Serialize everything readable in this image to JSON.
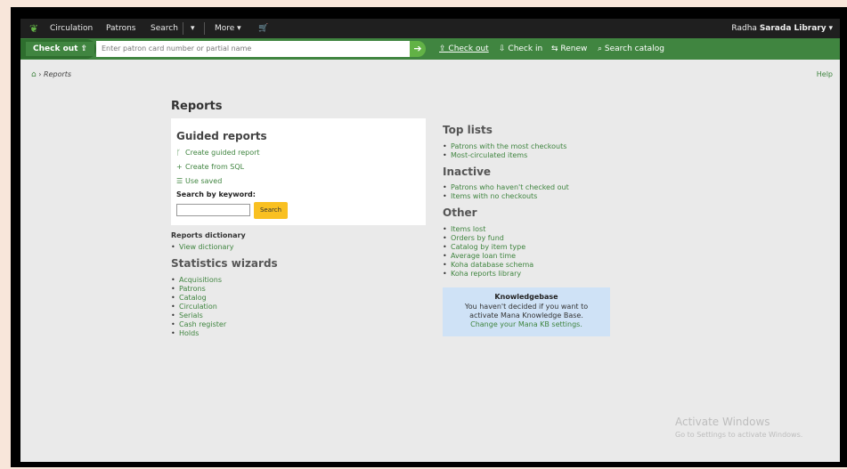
{
  "topnav": {
    "items": [
      "Circulation",
      "Patrons",
      "Search",
      "More"
    ],
    "user_prefix": "Radha",
    "library": "Sarada Library"
  },
  "checkout_bar": {
    "label": "Check out",
    "placeholder": "Enter patron card number or partial name",
    "links": [
      "Check out",
      "Check in",
      "Renew",
      "Search catalog"
    ]
  },
  "breadcrumb": {
    "current": "Reports"
  },
  "help_label": "Help",
  "page_title": "Reports",
  "guided": {
    "title": "Guided reports",
    "actions": [
      "Create guided report",
      "Create from SQL",
      "Use saved"
    ],
    "keyword_label": "Search by keyword:",
    "search_button": "Search"
  },
  "dictionary": {
    "title": "Reports dictionary",
    "items": [
      "View dictionary"
    ]
  },
  "stats": {
    "title": "Statistics wizards",
    "items": [
      "Acquisitions",
      "Patrons",
      "Catalog",
      "Circulation",
      "Serials",
      "Cash register",
      "Holds"
    ]
  },
  "top_lists": {
    "title": "Top lists",
    "items": [
      "Patrons with the most checkouts",
      "Most-circulated items"
    ]
  },
  "inactive": {
    "title": "Inactive",
    "items": [
      "Patrons who haven't checked out",
      "Items with no checkouts"
    ]
  },
  "other": {
    "title": "Other",
    "items": [
      "Items lost",
      "Orders by fund",
      "Catalog by item type",
      "Average loan time",
      "Koha database schema",
      "Koha reports library"
    ]
  },
  "knowledgebase": {
    "title": "Knowledgebase",
    "text": "You haven't decided if you want to activate Mana Knowledge Base.",
    "link": "Change your Mana KB settings."
  },
  "watermark": {
    "line1": "Activate Windows",
    "line2": "Go to Settings to activate Windows."
  },
  "colors": {
    "green": "#408540",
    "topnav": "#1f1f1f",
    "button": "#f9c021",
    "kb_bg": "#cfe2f6"
  }
}
